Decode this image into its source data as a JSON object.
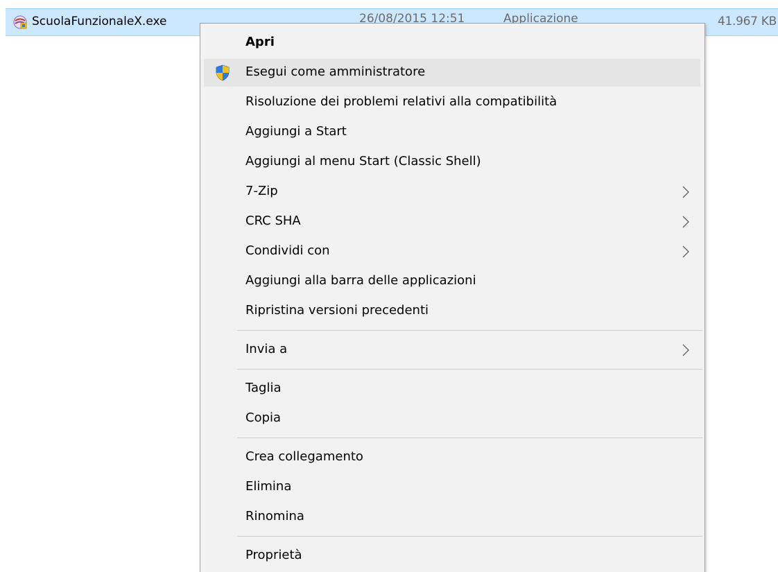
{
  "file": {
    "name": "ScuolaFunzionaleX.exe",
    "date": "26/08/2015 12:51",
    "type": "Applicazione",
    "size": "41.967 KB"
  },
  "menu": {
    "items": [
      {
        "label": "Apri"
      },
      {
        "label": "Esegui come amministratore"
      },
      {
        "label": "Risoluzione dei problemi relativi alla compatibilità"
      },
      {
        "label": "Aggiungi a Start"
      },
      {
        "label": "Aggiungi al menu Start (Classic Shell)"
      },
      {
        "label": "7-Zip"
      },
      {
        "label": "CRC SHA"
      },
      {
        "label": "Condividi con"
      },
      {
        "label": "Aggiungi alla barra delle applicazioni"
      },
      {
        "label": "Ripristina versioni precedenti"
      },
      {
        "label": "Invia a"
      },
      {
        "label": "Taglia"
      },
      {
        "label": "Copia"
      },
      {
        "label": "Crea collegamento"
      },
      {
        "label": "Elimina"
      },
      {
        "label": "Rinomina"
      },
      {
        "label": "Proprietà"
      }
    ]
  },
  "icons": {
    "file_icon": "application-exe-icon",
    "shield_icon": "uac-shield-icon",
    "submenu_arrow": "chevron-right-icon"
  },
  "colors": {
    "selection": "#cce8ff",
    "menu_background": "#f2f2f2",
    "hover": "#e5e5e5"
  }
}
